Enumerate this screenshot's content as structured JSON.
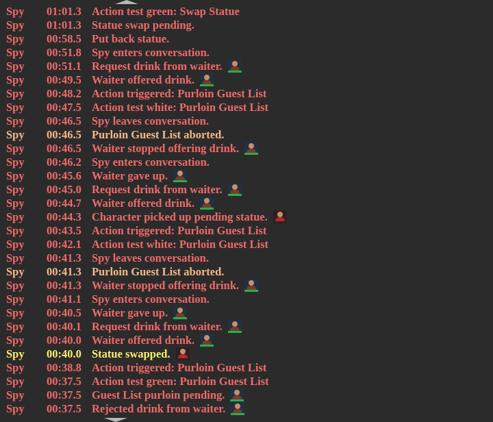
{
  "colors": {
    "background": "#2b2b2b",
    "red": "#f06a6a",
    "orange": "#f5b98a",
    "yellow": "#ffef70",
    "icon_underline": "#22b14c"
  },
  "log": [
    {
      "role": "Spy",
      "time": "01:01.3",
      "text": "Action test green: Swap Statue",
      "color": "red",
      "icon": ""
    },
    {
      "role": "Spy",
      "time": "01:01.3",
      "text": "Statue swap pending.",
      "color": "red",
      "icon": ""
    },
    {
      "role": "Spy",
      "time": "00:58.5",
      "text": "Put back statue.",
      "color": "red",
      "icon": ""
    },
    {
      "role": "Spy",
      "time": "00:51.8",
      "text": "Spy enters conversation.",
      "color": "red",
      "icon": ""
    },
    {
      "role": "Spy",
      "time": "00:51.1",
      "text": "Request drink from waiter.",
      "color": "red",
      "icon": "waiter-icon"
    },
    {
      "role": "Spy",
      "time": "00:49.5",
      "text": "Waiter offered drink.",
      "color": "red",
      "icon": "waiter-icon"
    },
    {
      "role": "Spy",
      "time": "00:48.2",
      "text": "Action triggered: Purloin Guest List",
      "color": "red",
      "icon": ""
    },
    {
      "role": "Spy",
      "time": "00:47.5",
      "text": "Action test white: Purloin Guest List",
      "color": "red",
      "icon": ""
    },
    {
      "role": "Spy",
      "time": "00:46.5",
      "text": "Spy leaves conversation.",
      "color": "red",
      "icon": ""
    },
    {
      "role": "Spy",
      "time": "00:46.5",
      "text": "Purloin Guest List aborted.",
      "color": "orange",
      "icon": ""
    },
    {
      "role": "Spy",
      "time": "00:46.5",
      "text": "Waiter stopped offering drink.",
      "color": "red",
      "icon": "waiter-icon"
    },
    {
      "role": "Spy",
      "time": "00:46.2",
      "text": "Spy enters conversation.",
      "color": "red",
      "icon": ""
    },
    {
      "role": "Spy",
      "time": "00:45.6",
      "text": "Waiter gave up.",
      "color": "red",
      "icon": "waiter-icon"
    },
    {
      "role": "Spy",
      "time": "00:45.0",
      "text": "Request drink from waiter.",
      "color": "red",
      "icon": "waiter-icon"
    },
    {
      "role": "Spy",
      "time": "00:44.7",
      "text": "Waiter offered drink.",
      "color": "red",
      "icon": "waiter-icon"
    },
    {
      "role": "Spy",
      "time": "00:44.3",
      "text": "Character picked up pending statue.",
      "color": "red",
      "icon": "character-icon"
    },
    {
      "role": "Spy",
      "time": "00:43.5",
      "text": "Action triggered: Purloin Guest List",
      "color": "red",
      "icon": ""
    },
    {
      "role": "Spy",
      "time": "00:42.1",
      "text": "Action test white: Purloin Guest List",
      "color": "red",
      "icon": ""
    },
    {
      "role": "Spy",
      "time": "00:41.3",
      "text": "Spy leaves conversation.",
      "color": "red",
      "icon": ""
    },
    {
      "role": "Spy",
      "time": "00:41.3",
      "text": "Purloin Guest List aborted.",
      "color": "orange",
      "icon": ""
    },
    {
      "role": "Spy",
      "time": "00:41.3",
      "text": "Waiter stopped offering drink.",
      "color": "red",
      "icon": "waiter-icon"
    },
    {
      "role": "Spy",
      "time": "00:41.1",
      "text": "Spy enters conversation.",
      "color": "red",
      "icon": ""
    },
    {
      "role": "Spy",
      "time": "00:40.5",
      "text": "Waiter gave up.",
      "color": "red",
      "icon": "waiter-icon"
    },
    {
      "role": "Spy",
      "time": "00:40.1",
      "text": "Request drink from waiter.",
      "color": "red",
      "icon": "waiter-icon"
    },
    {
      "role": "Spy",
      "time": "00:40.0",
      "text": "Waiter offered drink.",
      "color": "red",
      "icon": "waiter-icon"
    },
    {
      "role": "Spy",
      "time": "00:40.0",
      "text": "Statue swapped.",
      "color": "yellow",
      "icon": "character-icon"
    },
    {
      "role": "Spy",
      "time": "00:38.8",
      "text": "Action triggered: Purloin Guest List",
      "color": "red",
      "icon": ""
    },
    {
      "role": "Spy",
      "time": "00:37.5",
      "text": "Action test green: Purloin Guest List",
      "color": "red",
      "icon": ""
    },
    {
      "role": "Spy",
      "time": "00:37.5",
      "text": "Guest List purloin pending.",
      "color": "red",
      "icon": "waiter-icon"
    },
    {
      "role": "Spy",
      "time": "00:37.5",
      "text": "Rejected drink from waiter.",
      "color": "red",
      "icon": "waiter-icon"
    }
  ]
}
